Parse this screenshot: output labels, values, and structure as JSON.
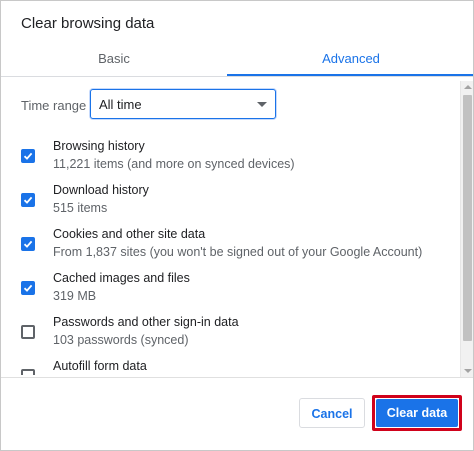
{
  "dialog": {
    "title": "Clear browsing data"
  },
  "tabs": [
    {
      "label": "Basic",
      "active": false
    },
    {
      "label": "Advanced",
      "active": true
    }
  ],
  "time_range": {
    "label": "Time range",
    "selected": "All time"
  },
  "items": [
    {
      "title": "Browsing history",
      "subtitle": "11,221 items (and more on synced devices)",
      "checked": true
    },
    {
      "title": "Download history",
      "subtitle": "515 items",
      "checked": true
    },
    {
      "title": "Cookies and other site data",
      "subtitle": "From 1,837 sites (you won't be signed out of your Google Account)",
      "checked": true
    },
    {
      "title": "Cached images and files",
      "subtitle": "319 MB",
      "checked": true
    },
    {
      "title": "Passwords and other sign-in data",
      "subtitle": "103 passwords (synced)",
      "checked": false
    },
    {
      "title": "Autofill form data",
      "subtitle": "",
      "checked": false
    }
  ],
  "buttons": {
    "cancel_label": "Cancel",
    "clear_label": "Clear data"
  },
  "colors": {
    "accent": "#1a73e8",
    "highlight_border": "#d0021b"
  }
}
